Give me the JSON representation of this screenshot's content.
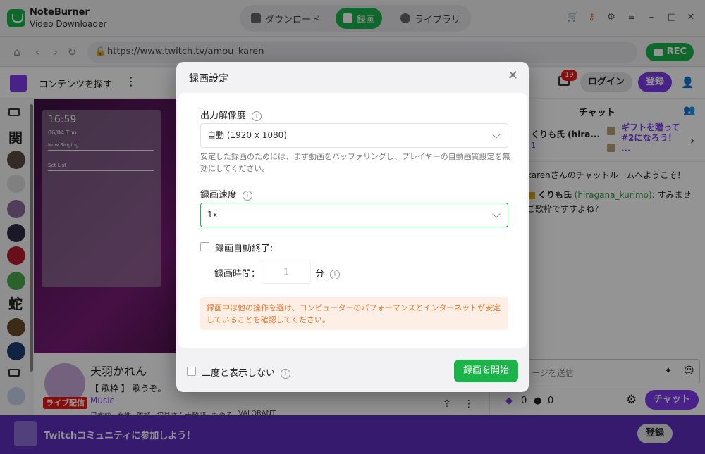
{
  "app": {
    "name": "NoteBurner",
    "subtitle": "Video Downloader"
  },
  "top_tabs": [
    {
      "label": "ダウンロード",
      "icon": "download-icon",
      "active": false
    },
    {
      "label": "録画",
      "icon": "video-camera-icon",
      "active": true
    },
    {
      "label": "ライブラリ",
      "icon": "clock-icon",
      "active": false
    }
  ],
  "address": {
    "url": "https://www.twitch.tv/amou_karen",
    "rec_label": "REC"
  },
  "twitch": {
    "browse_label": "コンテンツを探す",
    "notification_count": "19",
    "login_label": "ログイン",
    "signup_label": "登録",
    "stream_overlay_time": "16:59",
    "stream_overlay_date": "06/04 Thu",
    "stream_overlay_nowsinging": "Now Singing",
    "stream_overlay_setlist": "Set List",
    "streamer_name": "天羽かれん",
    "live_badge": "ライブ配信",
    "stream_title": "【 歌枠 】 歌うぞ。",
    "category": "Music",
    "tags": [
      "日本語",
      "女性",
      "雑談",
      "初見さん大歓迎",
      "たのそ",
      "VALORANT"
    ]
  },
  "chat": {
    "header": "チャット",
    "gift_user": "くりも氏 (hira...",
    "gift_count": "1",
    "gift_text": "ギフトを贈って#2になろう！",
    "gift_more": "...",
    "welcome": "karenさんのチャットルームへようこそ！",
    "msg_user": "くりも氏",
    "msg_handle": "(hiragana_kurimo)",
    "msg_text": ": すみませ",
    "msg_text2": "ご歌枠ですすよね？",
    "input_placeholder": "ージを送信",
    "points_a": "0",
    "points_b": "0",
    "chat_button": "チャット"
  },
  "banner": {
    "text": "Twitchコミュニティに参加しよう！",
    "button": "登録"
  },
  "modal": {
    "title": "録画設定",
    "resolution_label": "出力解像度",
    "resolution_value": "自動 (1920 x 1080)",
    "resolution_help": "安定した録画のためには、まず動画をバッファリングし、プレイヤーの自動画質設定を無効にしてください。",
    "speed_label": "録画速度",
    "speed_value": "1x",
    "auto_stop_label": "録画自動終了:",
    "duration_label": "録画時間：",
    "duration_value": "1",
    "duration_unit": "分",
    "warning": "録画中は他の操作を避け、コンピューターのパフォーマンスとインターネットが安定していることを確認してください。",
    "dont_show_label": "二度と表示しない",
    "start_button": "録画を開始"
  }
}
